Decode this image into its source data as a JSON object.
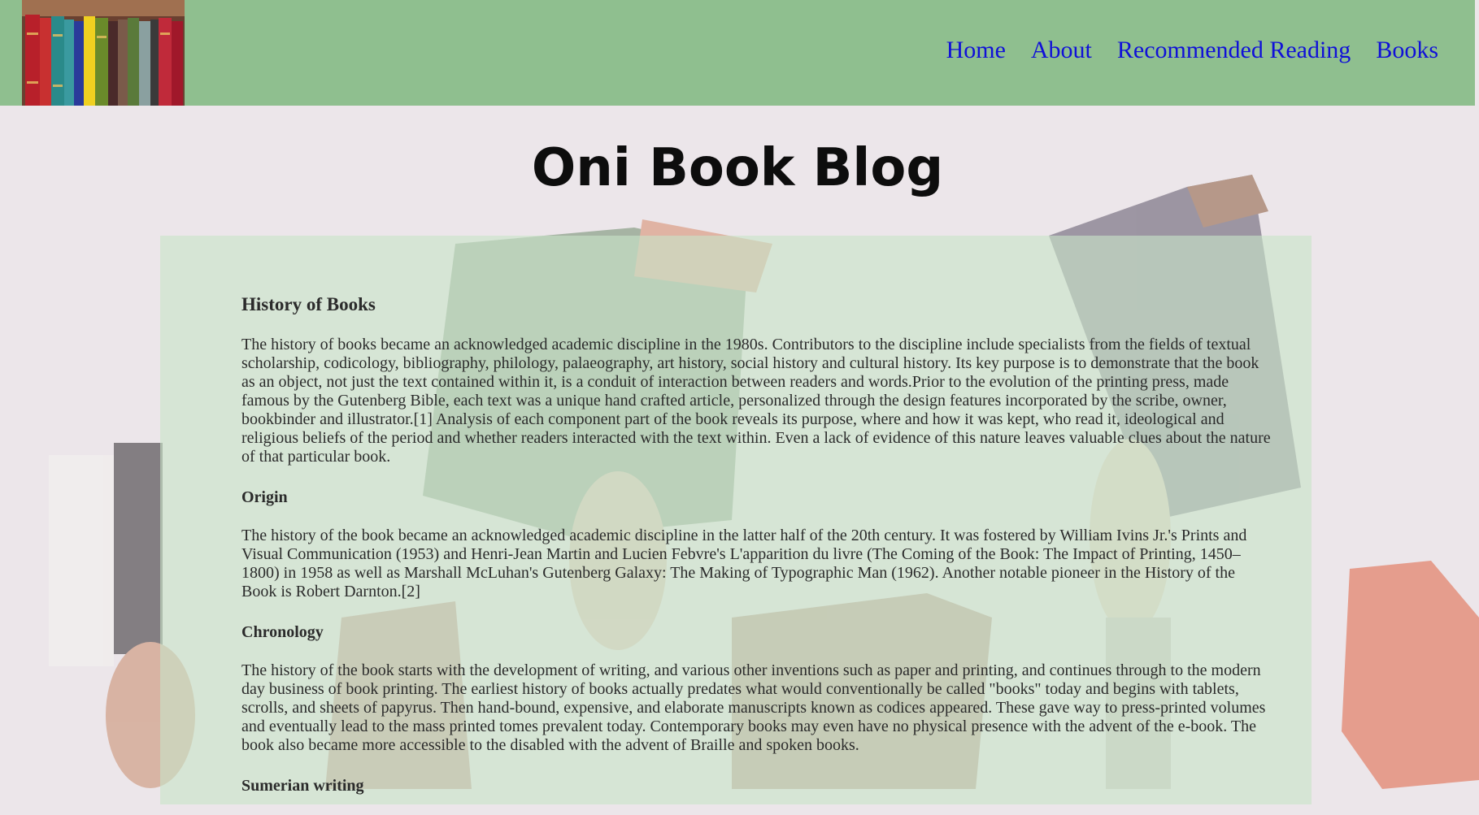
{
  "nav": {
    "logo_alt": "bookshelf logo",
    "links": [
      "Home",
      "About",
      "Recommended Reading",
      "Books"
    ]
  },
  "site_title": "Oni Book Blog",
  "article": {
    "title": "History of Books",
    "intro": "The history of books became an acknowledged academic discipline in the 1980s. Contributors to the discipline include specialists from the fields of textual scholarship, codicology, bibliography, philology, palaeography, art history, social history and cultural history. Its key purpose is to demonstrate that the book as an object, not just the text contained within it, is a conduit of interaction between readers and words.Prior to the evolution of the printing press, made famous by the Gutenberg Bible, each text was a unique hand crafted article, personalized through the design features incorporated by the scribe, owner, bookbinder and illustrator.[1] Analysis of each component part of the book reveals its purpose, where and how it was kept, who read it, ideological and religious beliefs of the period and whether readers interacted with the text within. Even a lack of evidence of this nature leaves valuable clues about the nature of that particular book.",
    "origin_heading": "Origin",
    "origin_text": "The history of the book became an acknowledged academic discipline in the latter half of the 20th century. It was fostered by William Ivins Jr.'s Prints and Visual Communication (1953) and Henri-Jean Martin and Lucien Febvre's L'apparition du livre (The Coming of the Book: The Impact of Printing, 1450–1800) in 1958 as well as Marshall McLuhan's Gutenberg Galaxy: The Making of Typographic Man (1962). Another notable pioneer in the History of the Book is Robert Darnton.[2]",
    "chronology_heading": "Chronology",
    "chronology_text": "The history of the book starts with the development of writing, and various other inventions such as paper and printing, and continues through to the modern day business of book printing. The earliest history of books actually predates what would conventionally be called \"books\" today and begins with tablets, scrolls, and sheets of papyrus. Then hand-bound, expensive, and elaborate manuscripts known as codices appeared. These gave way to press-printed volumes and eventually lead to the mass printed tomes prevalent today. Contemporary books may even have no physical presence with the advent of the e-book. The book also became more accessible to the disabled with the advent of Braille and spoken books.",
    "next_heading": "Sumerian writing"
  },
  "colors": {
    "navbar": "#8fbf8f",
    "link": "#1010d8",
    "panel": "#c8e4c8",
    "background": "#ece6ea"
  }
}
